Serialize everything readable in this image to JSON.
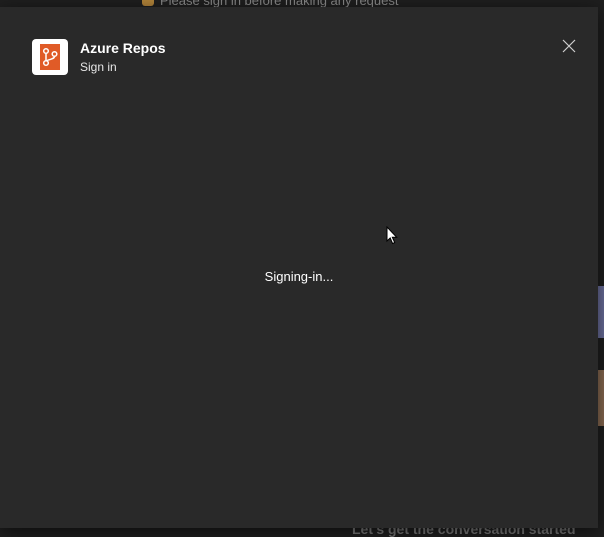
{
  "background": {
    "banner_text": "Please sign in before making any request",
    "footer_text": "Let's get the conversation started"
  },
  "dialog": {
    "app_name": "Azure Repos",
    "subtitle": "Sign in",
    "status_text": "Signing-in...",
    "icons": {
      "app": "azure-repos-icon",
      "close": "close-icon",
      "cursor": "mouse-pointer-icon"
    },
    "colors": {
      "dialog_bg": "#292929",
      "backdrop": "#1f1f1f",
      "app_icon_accent": "#e05b27",
      "text_primary": "#ffffff"
    }
  }
}
